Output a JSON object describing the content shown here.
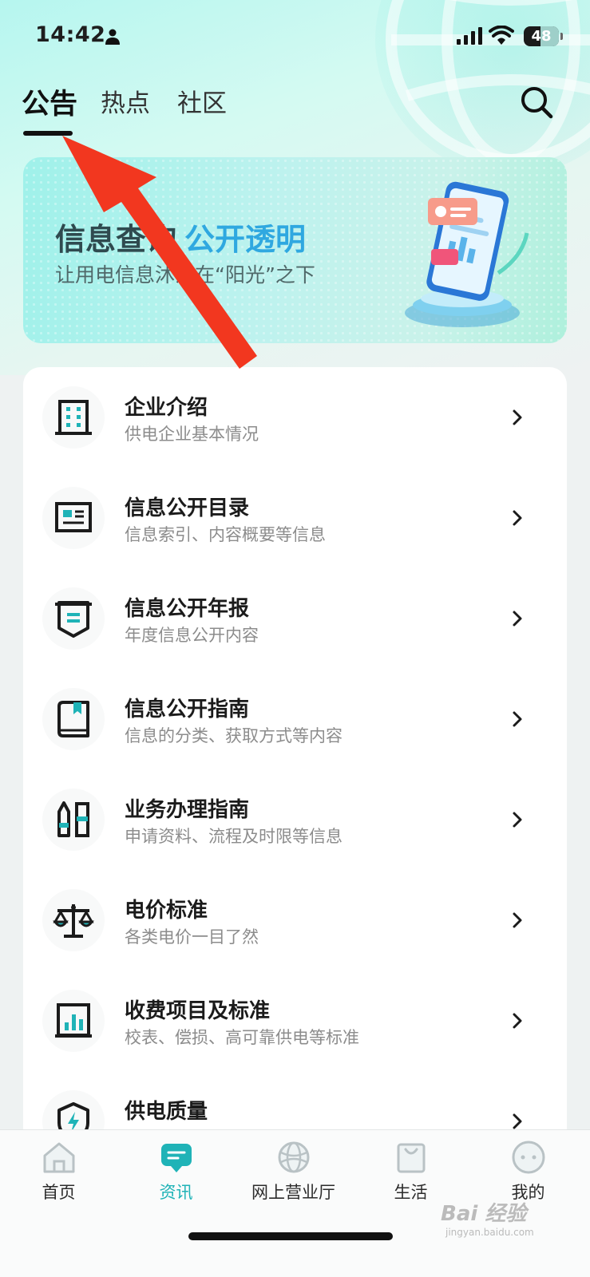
{
  "status_bar": {
    "time": "14:42",
    "battery": "48",
    "battery_level": 0.48
  },
  "tabs": [
    {
      "label": "公告",
      "active": true
    },
    {
      "label": "热点",
      "active": false
    },
    {
      "label": "社区",
      "active": false
    }
  ],
  "banner": {
    "title_main": "信息查询",
    "title_accent": "公开透明",
    "subtitle": "让用电信息沐浴在“阳光”之下"
  },
  "items": [
    {
      "title": "企业介绍",
      "subtitle": "供电企业基本情况",
      "icon": "building-icon"
    },
    {
      "title": "信息公开目录",
      "subtitle": "信息索引、内容概要等信息",
      "icon": "directory-icon"
    },
    {
      "title": "信息公开年报",
      "subtitle": "年度信息公开内容",
      "icon": "annual-report-icon"
    },
    {
      "title": "信息公开指南",
      "subtitle": "信息的分类、获取方式等内容",
      "icon": "guide-book-icon"
    },
    {
      "title": "业务办理指南",
      "subtitle": "申请资料、流程及时限等信息",
      "icon": "business-guide-icon"
    },
    {
      "title": "电价标准",
      "subtitle": "各类电价一目了然",
      "icon": "scale-icon"
    },
    {
      "title": "收费项目及标准",
      "subtitle": "校表、偿损、高可靠供电等标准",
      "icon": "fee-chart-icon"
    },
    {
      "title": "供电质量",
      "subtitle": "",
      "icon": "power-quality-icon"
    }
  ],
  "nav": [
    {
      "label": "首页",
      "icon": "home-icon",
      "active": false
    },
    {
      "label": "资讯",
      "icon": "news-icon",
      "active": true
    },
    {
      "label": "网上营业厅",
      "icon": "online-hall-icon",
      "active": false
    },
    {
      "label": "生活",
      "icon": "shopping-bag-icon",
      "active": false
    },
    {
      "label": "我的",
      "icon": "profile-icon",
      "active": false
    }
  ],
  "colors": {
    "accent": "#1fb3b7",
    "banner_blue": "#2fa8e0",
    "annotation_arrow": "#f2371f"
  },
  "watermark": {
    "main": "Bai 经验",
    "sub": "jingyan.baidu.com"
  }
}
